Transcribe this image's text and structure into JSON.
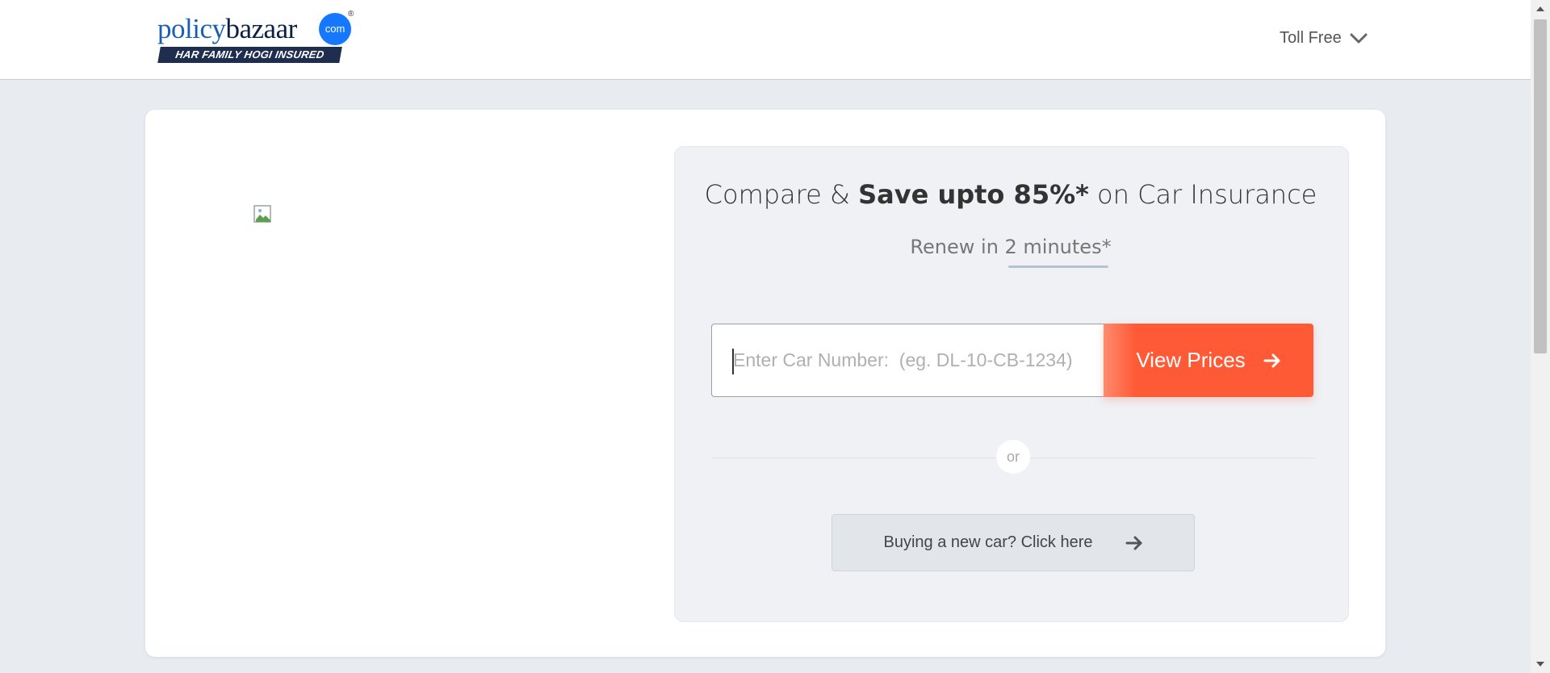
{
  "header": {
    "logo_main": "policy",
    "logo_second": "bazaar",
    "logo_dot": "com",
    "logo_reg": "®",
    "logo_tagline": "HAR FAMILY HOGI INSURED",
    "toll_free": "Toll Free"
  },
  "hero": {
    "headline_pre": "Compare & ",
    "headline_bold": "Save upto 85%*",
    "headline_post": " on Car Insurance",
    "subtitle": "Renew in 2 minutes*"
  },
  "form": {
    "car_number_placeholder": "Enter Car Number:  (eg. DL-10-CB-1234)",
    "car_number_value": "",
    "view_prices_label": "View Prices",
    "or_label": "or",
    "new_car_label": "Buying a new car? Click here"
  },
  "colors": {
    "brand_blue": "#1677ff",
    "cta_orange": "#ff5a36",
    "panel_bg": "#eff1f5"
  },
  "icons": {
    "toll_free_chevron": "chevron-down-icon",
    "view_prices_arrow": "arrow-right-icon",
    "new_car_arrow": "arrow-right-icon",
    "hero_image": "broken-image-icon"
  }
}
